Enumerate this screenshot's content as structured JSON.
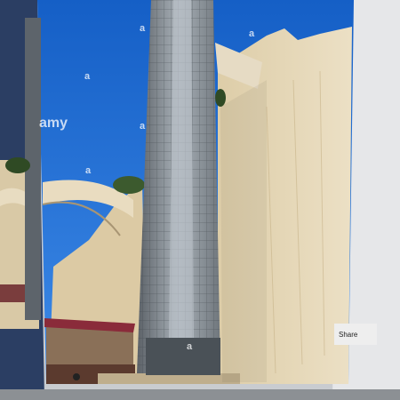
{
  "photo": {
    "subject": "glass-elevator-tower-by-limestone-bastion",
    "watermark_letter": "a",
    "watermark_fragment": "amy"
  },
  "sidebar": {
    "share_label": "Share"
  },
  "colors": {
    "sky": "#1d6fd8",
    "stone": "#e3d4b3",
    "tower_steel": "#8b949c",
    "monitor_bezel": "#d8dadd"
  }
}
